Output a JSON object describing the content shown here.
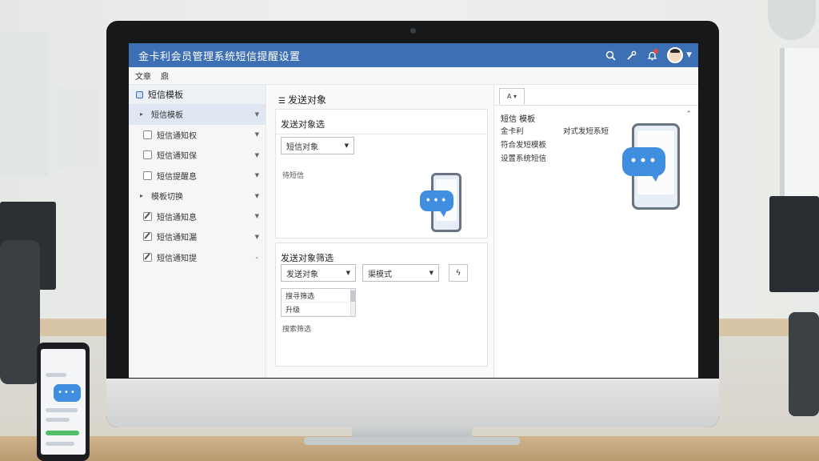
{
  "app": {
    "title": "金卡利会员管理系统短信提醒设置"
  },
  "menubar": [
    "文章",
    "鼎"
  ],
  "sidebar": {
    "header": "短信模板",
    "items": [
      {
        "label": "短信模板",
        "kind": "arrow",
        "active": true
      },
      {
        "label": "短信通知权",
        "kind": "checkbox"
      },
      {
        "label": "短信通知保",
        "kind": "checkbox"
      },
      {
        "label": "短信提醒息",
        "kind": "checkbox"
      },
      {
        "label": "模板切换",
        "kind": "arrow"
      },
      {
        "label": "短信通知息",
        "kind": "edit"
      },
      {
        "label": "短信通知漏",
        "kind": "edit"
      },
      {
        "label": "短信通知提",
        "kind": "edit"
      }
    ]
  },
  "middle": {
    "title": "发送对象",
    "panel1": {
      "title": "发送对象选",
      "select_value": "短信对象",
      "hint": "待短信"
    },
    "panel2": {
      "title": "发送对象筛选",
      "select1_value": "发送对象",
      "select2_value": "渠模式",
      "list_rows": [
        "搜寻筛选",
        "升级"
      ],
      "footer": "搜索筛选"
    }
  },
  "right": {
    "tab_label": "A ▾",
    "header": "短信 模板",
    "rows": [
      {
        "label": "金卡利",
        "value": "对式发短系短"
      },
      {
        "label": "符合发短模板",
        "value": ""
      },
      {
        "label": "设置系统短信",
        "value": ""
      }
    ]
  },
  "icons": {
    "search": "search-icon",
    "tools": "wrench-icon",
    "bell": "bell-icon"
  },
  "colors": {
    "titlebar": "#3d6fb5",
    "accent_blue": "#3f8ee0",
    "notification": "#e34b4b"
  }
}
